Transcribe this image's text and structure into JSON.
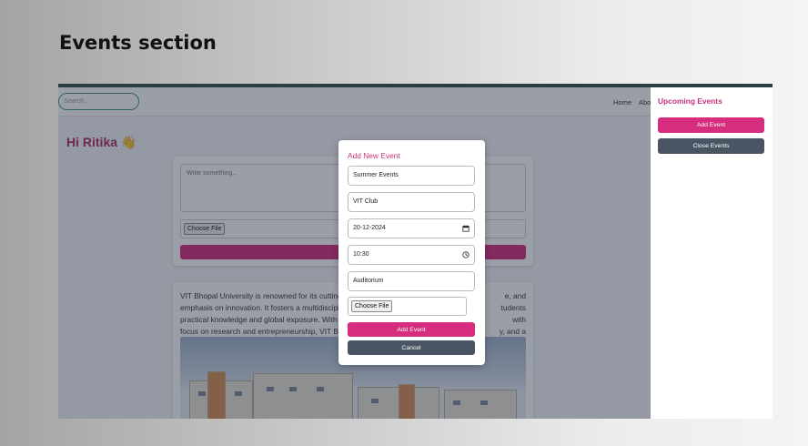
{
  "slide": {
    "title": "Events section"
  },
  "navbar": {
    "search_placeholder": "Search...",
    "links": [
      "Home",
      "Abo"
    ]
  },
  "greeting": "Hi Ritika 👋",
  "post": {
    "placeholder": "Write something...",
    "choose_file_label": "Choose File"
  },
  "about": {
    "lines": [
      "VIT Bhopal University is renowned for its cutting",
      "emphasis on innovation. It fosters a multidiscipl",
      "practical knowledge and global exposure. With",
      "focus on research and entrepreneurship, VIT Bh"
    ],
    "right_fragments": [
      "e, and",
      "tudents with",
      "y, and a"
    ]
  },
  "sidebar": {
    "title": "Upcoming Events",
    "add_button": "Add Event",
    "close_button": "Close Events"
  },
  "modal": {
    "title": "Add New Event",
    "fields": {
      "name": "Summer Events",
      "organizer": "VIT Club",
      "date": "20-12-2024",
      "time": "10:30",
      "venue": "Auditorium"
    },
    "choose_file_label": "Choose File",
    "add_button": "Add Event",
    "cancel_button": "Cancel"
  },
  "colors": {
    "accent": "#d62d7e",
    "heading": "#c9307a",
    "secondary": "#4a5563",
    "search_border": "#3e9a72"
  }
}
